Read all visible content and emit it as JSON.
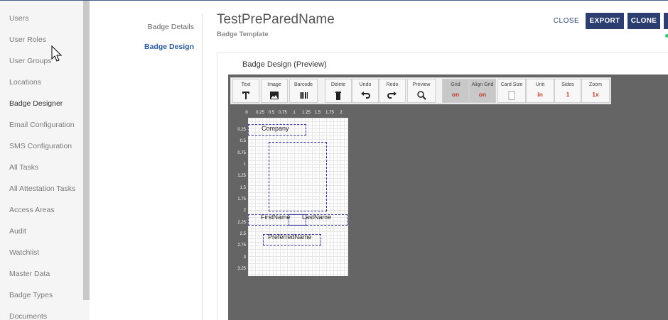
{
  "sidebar": {
    "items": [
      {
        "label": "Users"
      },
      {
        "label": "User Roles"
      },
      {
        "label": "User Groups"
      },
      {
        "label": "Locations"
      },
      {
        "label": "Badge Designer",
        "active": true
      },
      {
        "label": "Email Configuration"
      },
      {
        "label": "SMS Configuration"
      },
      {
        "label": "All Tasks"
      },
      {
        "label": "All Attestation Tasks"
      },
      {
        "label": "Access Areas"
      },
      {
        "label": "Audit"
      },
      {
        "label": "Watchlist"
      },
      {
        "label": "Master Data"
      },
      {
        "label": "Badge Types"
      },
      {
        "label": "Documents"
      }
    ]
  },
  "subnav": {
    "items": [
      {
        "label": "Badge Details"
      },
      {
        "label": "Badge Design",
        "active": true
      }
    ]
  },
  "header": {
    "title": "TestPreParedName",
    "subtitle": "Badge Template",
    "close_label": "CLOSE",
    "export_label": "EXPORT",
    "clone_label": "CLONE"
  },
  "card": {
    "title": "Badge Design (Preview)"
  },
  "toolbar": {
    "text": {
      "label": "Text",
      "icon": "text-icon"
    },
    "image": {
      "label": "Image",
      "icon": "image-icon"
    },
    "barcode": {
      "label": "Barcode",
      "icon": "barcode-icon"
    },
    "delete": {
      "label": "Delete",
      "icon": "trash-icon"
    },
    "undo": {
      "label": "Undo",
      "icon": "undo-icon"
    },
    "redo": {
      "label": "Redo",
      "icon": "redo-icon"
    },
    "preview": {
      "label": "Preview",
      "icon": "search-icon"
    },
    "grid": {
      "label": "Grid",
      "value": "on"
    },
    "align_grid": {
      "label": "Align Grid",
      "value": "on"
    },
    "card_size": {
      "label": "Card Size"
    },
    "unit": {
      "label": "Unit",
      "value": "in"
    },
    "sides": {
      "label": "Sides",
      "value": "1"
    },
    "zoom": {
      "label": "Zoom",
      "value": "1x"
    }
  },
  "ruler": {
    "horizontal": [
      "0",
      "0.25",
      "0.5",
      "0.75",
      "1",
      "1.25",
      "1.5",
      "1.75",
      "2"
    ],
    "vertical": [
      "0.25",
      "0.5",
      "0.75",
      "1",
      "1.25",
      "1.5",
      "1.75",
      "2",
      "2.25",
      "2.5",
      "2.75",
      "3",
      "3.25"
    ]
  },
  "badge_fields": {
    "company": "Company",
    "first_name": "FirstName",
    "last_name": "LastName",
    "preferred_name": "PreferredName"
  },
  "colors": {
    "primary_button": "#2c3e70",
    "active_nav": "#2c5b9c",
    "toggle_value": "#c0392b",
    "canvas_bg": "#656565",
    "field_border": "#3a3aa0"
  }
}
